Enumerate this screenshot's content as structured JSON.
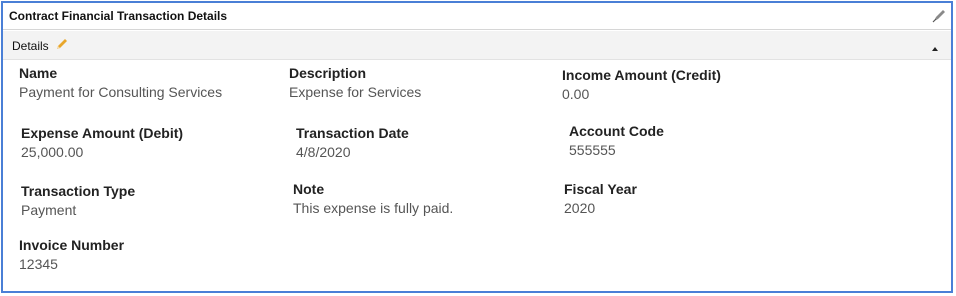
{
  "panel": {
    "title": "Contract Financial Transaction Details",
    "tool_icon": "pen-nib-icon"
  },
  "section": {
    "title": "Details",
    "edit_icon": "pencil-icon",
    "collapse_icon": "triangle-up-icon"
  },
  "fields": {
    "name": {
      "label": "Name",
      "value": "Payment for Consulting Services"
    },
    "description": {
      "label": "Description",
      "value": "Expense for Services"
    },
    "income_amount": {
      "label": "Income Amount (Credit)",
      "value": "0.00"
    },
    "expense_amount": {
      "label": "Expense Amount (Debit)",
      "value": "25,000.00"
    },
    "transaction_date": {
      "label": "Transaction Date",
      "value": "4/8/2020"
    },
    "account_code": {
      "label": "Account Code",
      "value": "555555"
    },
    "transaction_type": {
      "label": "Transaction Type",
      "value": "Payment"
    },
    "note": {
      "label": "Note",
      "value": "This expense is fully paid."
    },
    "fiscal_year": {
      "label": "Fiscal Year",
      "value": "2020"
    },
    "invoice_number": {
      "label": "Invoice Number",
      "value": "12345"
    }
  },
  "colors": {
    "frame_border": "#4a7fd6",
    "section_bg": "#f3f3f3",
    "pencil": "#e8a62a"
  }
}
